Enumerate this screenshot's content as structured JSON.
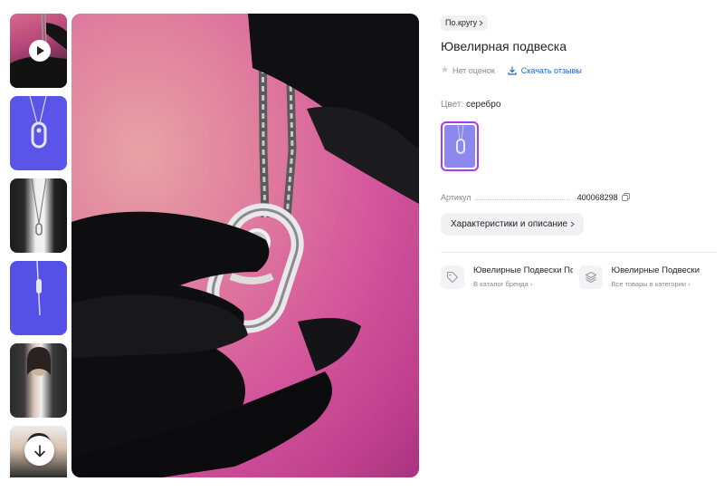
{
  "product": {
    "brand": "По.кругу",
    "title": "Ювелирная подвеска",
    "rating_text": "Нет оценок",
    "download_reviews": "Скачать отзывы",
    "color_label": "Цвет:",
    "color_value": "серебро",
    "article_label": "Артикул",
    "article_value": "400068298",
    "specs_button": "Характеристики и описание"
  },
  "categories": [
    {
      "title": "Ювелирные Подвески По",
      "subtitle": "В каталог бренда ›",
      "icon": "tag-icon"
    },
    {
      "title": "Ювелирные Подвески",
      "subtitle": "Все товары в категории ›",
      "icon": "layers-icon"
    }
  ],
  "colors": {
    "accent": "#a73afd",
    "link": "#1f66d1",
    "muted": "#868695"
  },
  "gallery": {
    "thumbnails": [
      "video",
      "pendant-on-blue",
      "model-black-jacket",
      "chain-on-blue",
      "model-portrait",
      "model-man"
    ],
    "active_index": 0
  }
}
